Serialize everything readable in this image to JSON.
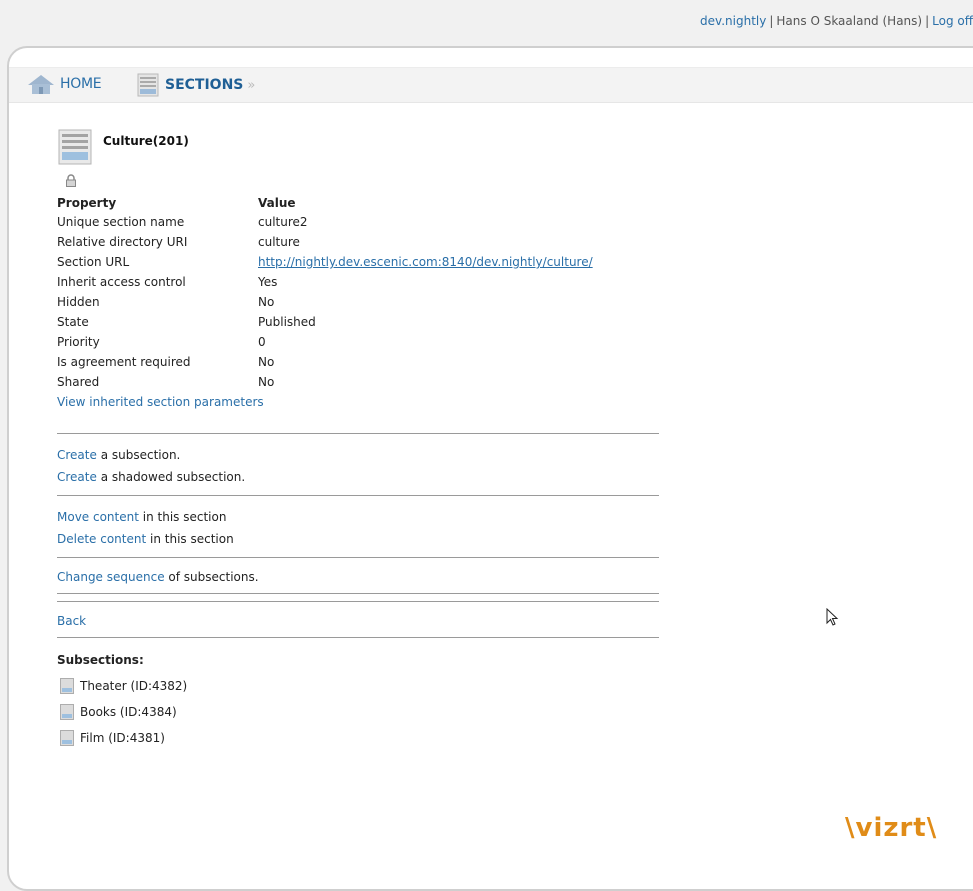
{
  "topbar": {
    "publication_link": "dev.nightly",
    "user_name": "Hans O Skaaland (Hans)",
    "logout_link": "Log off"
  },
  "nav": {
    "home_label": "HOME",
    "sections_label": "SECTIONS",
    "separator": "»"
  },
  "section": {
    "title": "Culture(201)",
    "header_property": "Property",
    "header_value": "Value",
    "properties": [
      {
        "name": "Unique section name",
        "value": "culture2"
      },
      {
        "name": "Relative directory URI",
        "value": "culture"
      },
      {
        "name": "Section URL",
        "value": "http://nightly.dev.escenic.com:8140/dev.nightly/culture/"
      },
      {
        "name": "Inherit access control",
        "value": "Yes"
      },
      {
        "name": "Hidden",
        "value": "No"
      },
      {
        "name": "State",
        "value": "Published"
      },
      {
        "name": "Priority",
        "value": "0"
      },
      {
        "name": "Is agreement required",
        "value": "No"
      },
      {
        "name": "Shared",
        "value": "No"
      }
    ],
    "inherited_params_link": "View inherited section parameters"
  },
  "actions": {
    "create_link": "Create",
    "create_subsection_text": " a subsection.",
    "create_shadowed_link": "Create",
    "create_shadowed_text": " a shadowed subsection.",
    "move_link": "Move content",
    "move_text": " in this section",
    "delete_link": "Delete content",
    "delete_text": " in this section",
    "sequence_link": "Change sequence",
    "sequence_text": " of subsections.",
    "back_link": "Back"
  },
  "subsections": {
    "title": "Subsections:",
    "items": [
      {
        "label": "Theater (ID:4382)"
      },
      {
        "label": "Books (ID:4384)"
      },
      {
        "label": "Film (ID:4381)"
      }
    ]
  },
  "logo": {
    "text": "\\vizrt\\",
    "color": "#e08c18"
  },
  "colors": {
    "link": "#2a6fa8",
    "nav_active": "#1f5f95"
  }
}
